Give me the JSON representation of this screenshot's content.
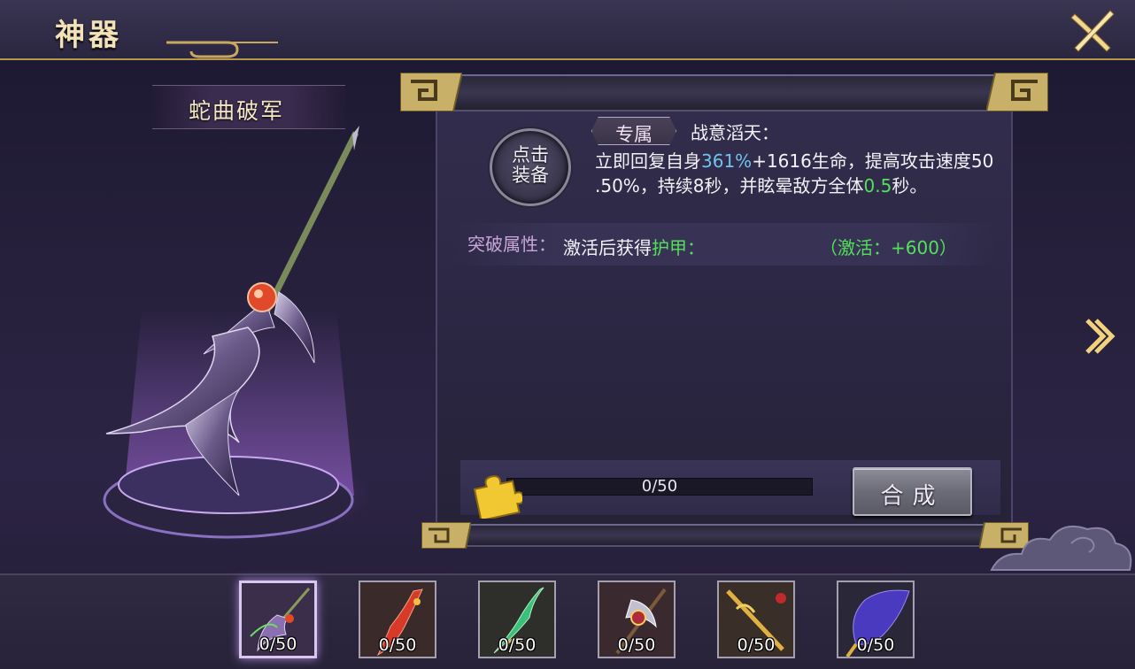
{
  "header": {
    "title": "神器"
  },
  "weapon": {
    "name": "蛇曲破军"
  },
  "panel": {
    "equip_button": [
      "点击",
      "装备"
    ],
    "exclusive_tag": "专属",
    "skill_name": "战意滔天：",
    "skill_desc": {
      "p1": "立即回复自身",
      "v1": "361%",
      "p2": "+1616生命，提高攻击速度50",
      "p3": ".50%，持续8秒，并眩晕敌方全体",
      "v2": "0.5",
      "p4": "秒。"
    },
    "breakthrough": {
      "label": "突破属性：",
      "text": "激活后获得",
      "attr": "护甲：",
      "value": "（激活：+600）"
    },
    "progress": {
      "current": 0,
      "max": 50,
      "text": "0/50"
    },
    "compose_button": "合成"
  },
  "slots": [
    {
      "count": "0/50",
      "selected": true,
      "icon": "purple-scythe-icon"
    },
    {
      "count": "0/50",
      "selected": false,
      "icon": "red-blade-icon"
    },
    {
      "count": "0/50",
      "selected": false,
      "icon": "jade-dragon-sword-icon"
    },
    {
      "count": "0/50",
      "selected": false,
      "icon": "crescent-axe-icon"
    },
    {
      "count": "0/50",
      "selected": false,
      "icon": "golden-staff-icon"
    },
    {
      "count": "0/50",
      "selected": false,
      "icon": "feather-fan-icon"
    }
  ],
  "colors": {
    "accent_gold": "#f3e2b8",
    "highlight_blue": "#6fc4ee",
    "highlight_green": "#53e05a"
  }
}
